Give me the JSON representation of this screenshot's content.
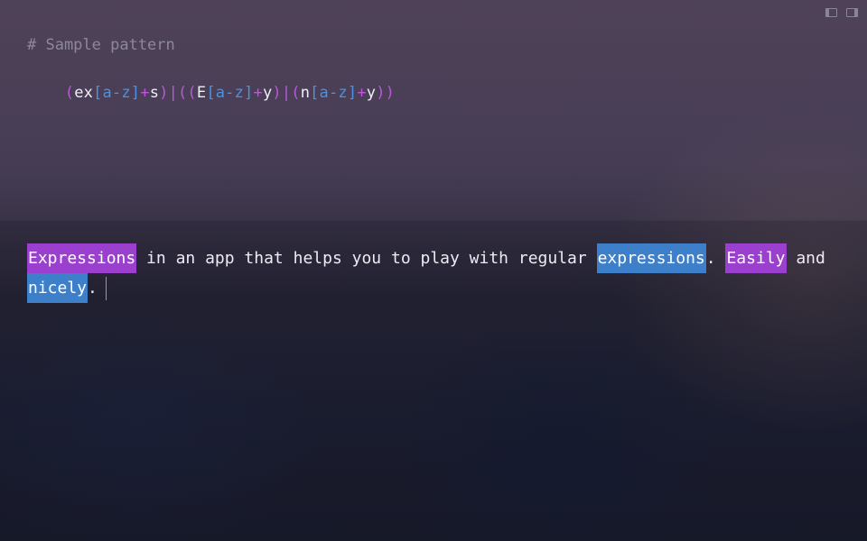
{
  "window": {
    "controls": [
      {
        "icon": "left-sidebar-toggle-icon"
      },
      {
        "icon": "right-sidebar-toggle-icon"
      }
    ]
  },
  "pattern": {
    "comment": "# Sample pattern",
    "tokens": [
      {
        "text": "(",
        "kind": "group"
      },
      {
        "text": "ex",
        "kind": "lit"
      },
      {
        "text": "[a-z]",
        "kind": "class"
      },
      {
        "text": "+",
        "kind": "quant"
      },
      {
        "text": "s",
        "kind": "lit"
      },
      {
        "text": ")",
        "kind": "group"
      },
      {
        "text": "|",
        "kind": "alt"
      },
      {
        "text": "((",
        "kind": "group"
      },
      {
        "text": "E",
        "kind": "lit"
      },
      {
        "text": "[a-z]",
        "kind": "class"
      },
      {
        "text": "+",
        "kind": "quant"
      },
      {
        "text": "y",
        "kind": "lit"
      },
      {
        "text": ")",
        "kind": "group"
      },
      {
        "text": "|",
        "kind": "alt"
      },
      {
        "text": "(",
        "kind": "group"
      },
      {
        "text": "n",
        "kind": "lit"
      },
      {
        "text": "[a-z]",
        "kind": "class"
      },
      {
        "text": "+",
        "kind": "quant"
      },
      {
        "text": "y",
        "kind": "lit"
      },
      {
        "text": "))",
        "kind": "group"
      }
    ]
  },
  "test_text": {
    "line1": {
      "m1": "Expressions",
      "t1": " in an app that helps you to play with regular ",
      "m2": "expressions",
      "t2": ". ",
      "m3": "Easily",
      "t3": " and"
    },
    "line2": {
      "m4": "nicely",
      "t4": "."
    }
  },
  "colors": {
    "match_group_1": "#9b3fcf",
    "match_group_2": "#3e7fc9",
    "pattern_group": "#b858d8",
    "pattern_class": "#4b92e0",
    "comment": "#8d8898"
  }
}
